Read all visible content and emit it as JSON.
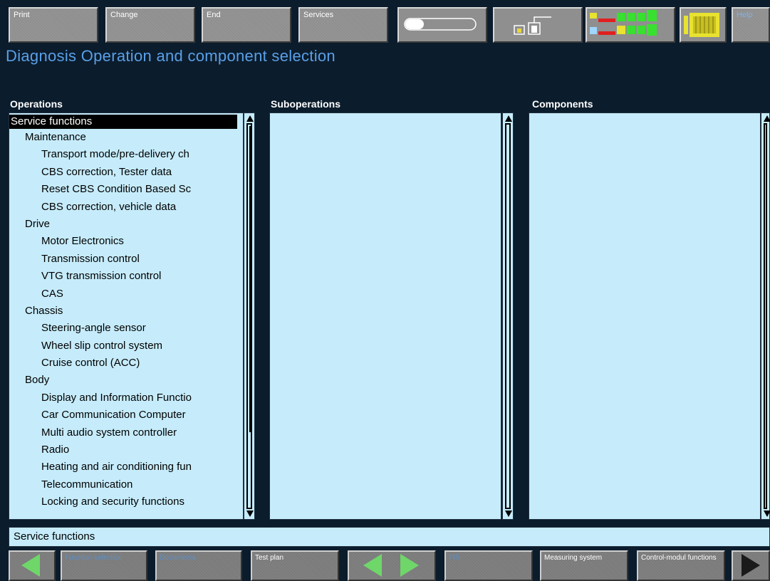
{
  "toolbar": {
    "print_label": "Print",
    "change_label": "Change",
    "end_label": "End",
    "services_label": "Services",
    "help_label": "Help"
  },
  "header": {
    "title": "Diagnosis  Operation and component selection"
  },
  "columns": {
    "operations": "Operations",
    "suboperations": "Suboperations",
    "components": "Components"
  },
  "operations": [
    {
      "label": "Service functions",
      "level": 0,
      "selected": true
    },
    {
      "label": "Maintenance",
      "level": 1
    },
    {
      "label": "Transport mode/pre-delivery ch",
      "level": 2
    },
    {
      "label": "CBS correction, Tester data",
      "level": 2
    },
    {
      "label": "Reset CBS Condition Based Sc",
      "level": 2
    },
    {
      "label": "CBS correction, vehicle data",
      "level": 2
    },
    {
      "label": "Drive",
      "level": 1
    },
    {
      "label": "Motor Electronics",
      "level": 2
    },
    {
      "label": "Transmission control",
      "level": 2
    },
    {
      "label": "VTG transmission control",
      "level": 2
    },
    {
      "label": "CAS",
      "level": 2
    },
    {
      "label": "Chassis",
      "level": 1
    },
    {
      "label": "Steering-angle sensor",
      "level": 2
    },
    {
      "label": "Wheel slip control system",
      "level": 2
    },
    {
      "label": "Cruise control (ACC)",
      "level": 2
    },
    {
      "label": "Body",
      "level": 1
    },
    {
      "label": "Display and Information Functio",
      "level": 2
    },
    {
      "label": "Car Communication Computer",
      "level": 2
    },
    {
      "label": "Multi audio system controller",
      "level": 2
    },
    {
      "label": "Radio",
      "level": 2
    },
    {
      "label": "Heating and air conditioning fun",
      "level": 2
    },
    {
      "label": "Telecommunication",
      "level": 2
    },
    {
      "label": "Locking and security functions",
      "level": 2
    }
  ],
  "status": {
    "text": "Service functions"
  },
  "bottom_toolbar": {
    "function_selection": "Function selection",
    "documents": "Documents",
    "test_plan": "Test plan",
    "fis": "FIS",
    "measuring_system": "Measuring system",
    "control_module_functions": "Control-modul functions"
  },
  "colors": {
    "accent": "#5aa0e8",
    "panel": "#c6ecfb",
    "background": "#0b1c2c",
    "nav_arrow": "#6fd66a"
  }
}
